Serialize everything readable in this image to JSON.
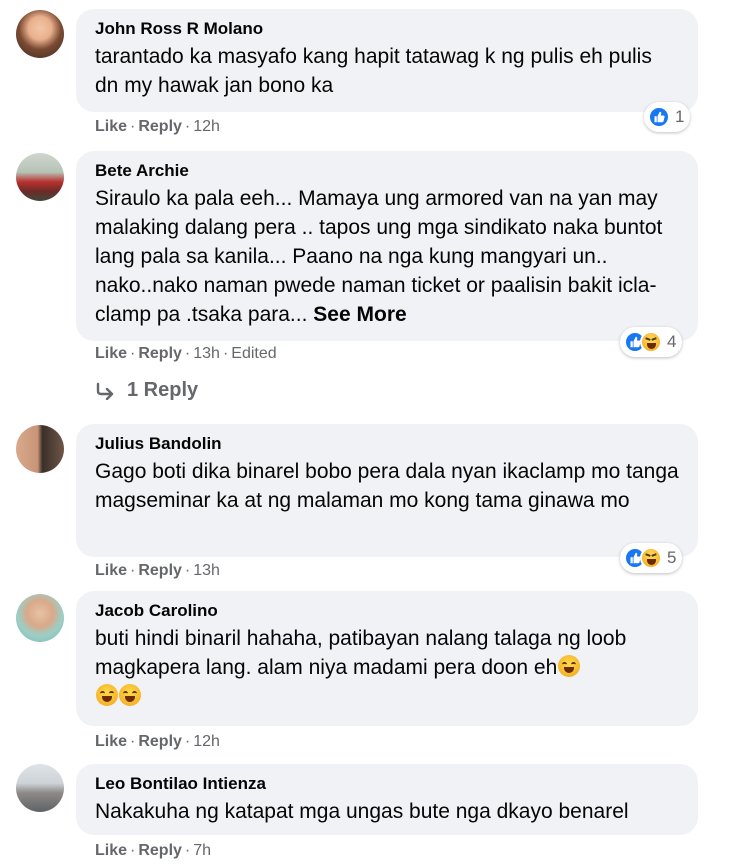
{
  "comments": [
    {
      "author": "John Ross R Molano",
      "text": "tarantado ka masyafo kang hapit tatawag k ng pulis eh pulis dn my hawak jan bono ka",
      "like": "Like",
      "reply": "Reply",
      "time": "12h",
      "reaction_count": "1"
    },
    {
      "author": "Bete Archie",
      "text": "Siraulo ka pala eeh... Mamaya ung armored van na yan may malaking dalang pera .. tapos ung mga sindikato naka buntot lang pala sa kanila... Paano na nga kung mangyari un.. nako..nako naman pwede naman ticket or paalisin bakit icla-clamp pa .tsaka para...",
      "see_more": "See More",
      "like": "Like",
      "reply": "Reply",
      "time": "13h",
      "edited": "Edited",
      "reaction_count": "4",
      "replies_link": "1 Reply"
    },
    {
      "author": "Julius Bandolin",
      "text": "Gago boti dika binarel bobo pera dala nyan ikaclamp mo tanga magseminar ka at ng malaman mo kong tama ginawa mo",
      "like": "Like",
      "reply": "Reply",
      "time": "13h",
      "reaction_count": "5"
    },
    {
      "author": "Jacob Carolino",
      "text": "buti hindi binaril hahaha, patibayan nalang talaga ng loob magkapera lang. alam niya madami pera doon eh",
      "like": "Like",
      "reply": "Reply",
      "time": "12h"
    },
    {
      "author": "Leo Bontilao Intienza",
      "text": "Nakakuha ng katapat mga ungas bute nga dkayo benarel",
      "like": "Like",
      "reply": "Reply",
      "time": "7h"
    }
  ],
  "icons": {
    "like_reaction": "like-icon",
    "haha_reaction": "haha-icon",
    "reply_arrow": "reply-arrow-icon",
    "laughing_emoji": "rolling-laughing-emoji"
  },
  "colors": {
    "bubble": "#f0f2f5",
    "secondary_text": "#65676b",
    "like_blue": "#1877f2"
  }
}
